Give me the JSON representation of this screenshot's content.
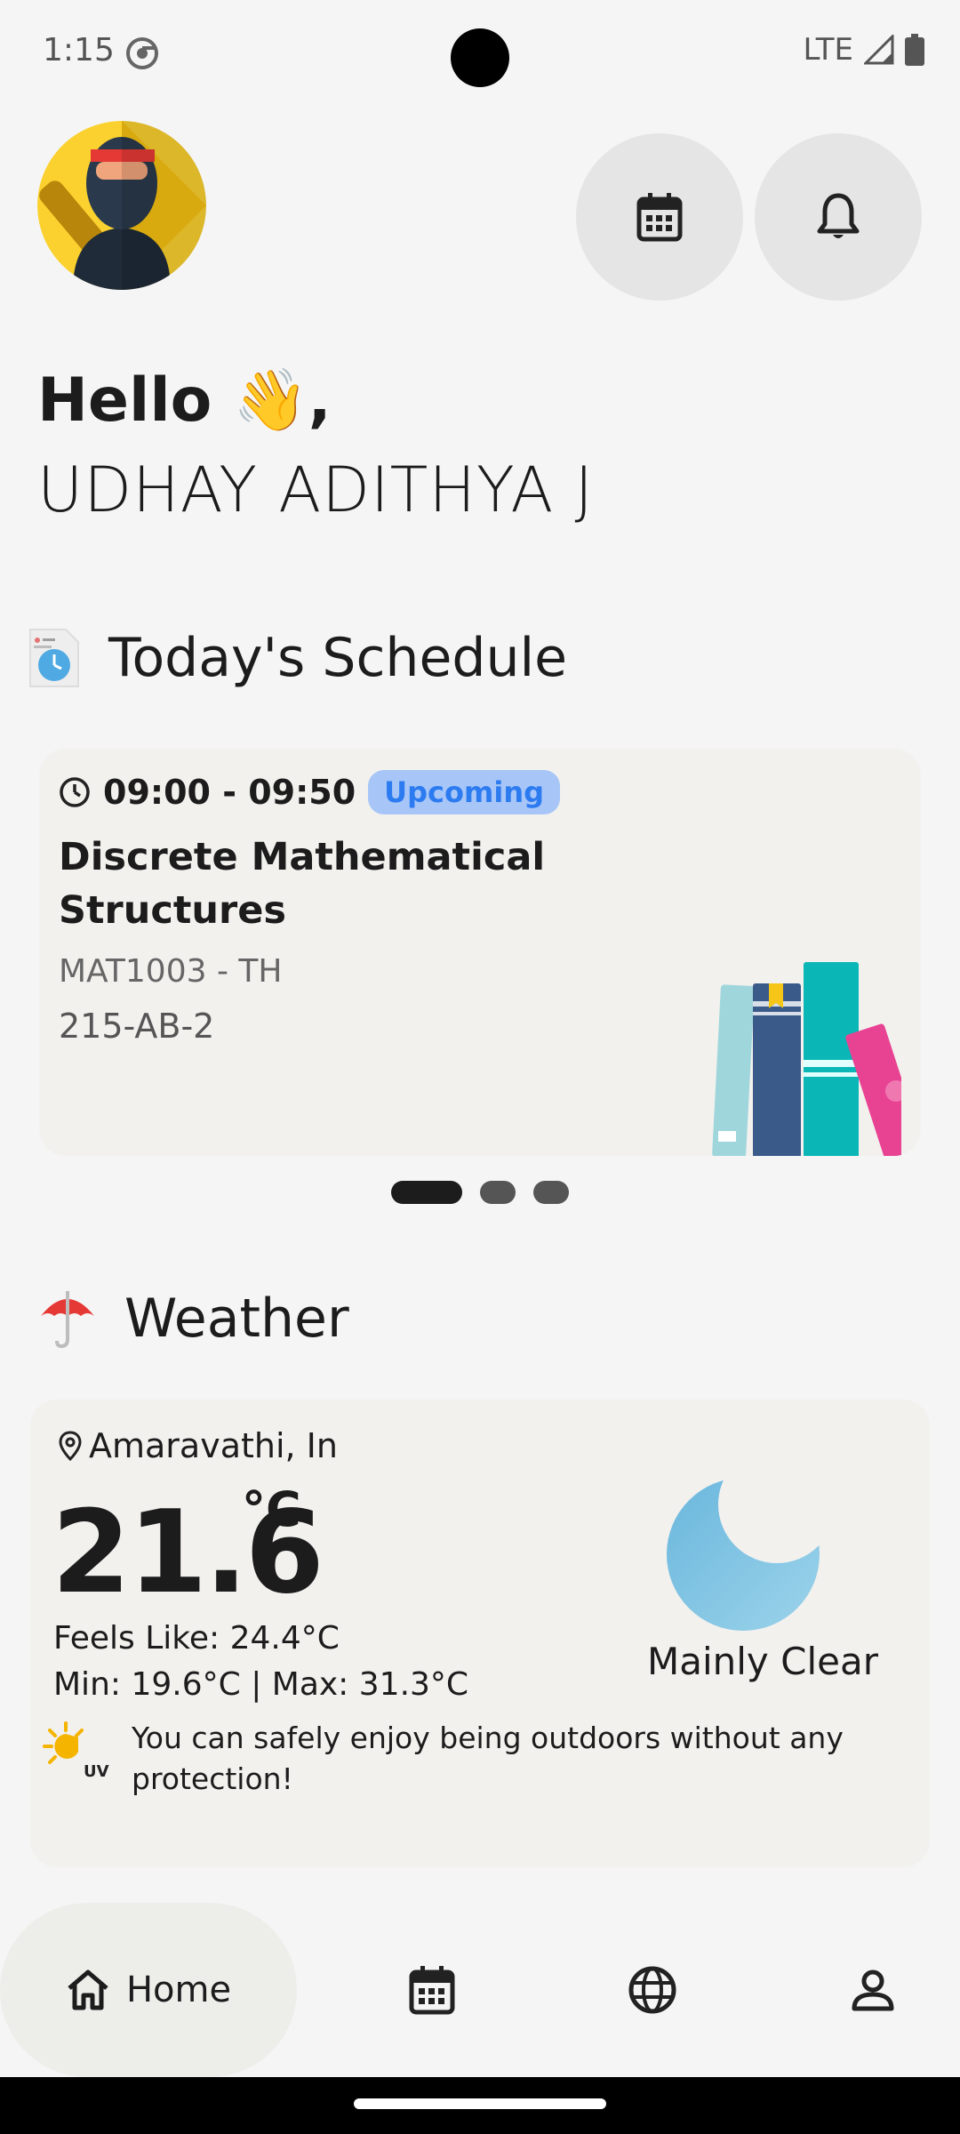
{
  "status_bar": {
    "time": "1:15",
    "network": "LTE"
  },
  "header": {
    "greeting": "Hello 👋,",
    "username": "UDHAY ADITHYA J"
  },
  "schedule": {
    "title": "Today's Schedule",
    "card": {
      "time": "09:00 - 09:50",
      "status": "Upcoming",
      "course_name": "Discrete Mathematical Structures",
      "course_code": "MAT1003 - TH",
      "room": "215-AB-2"
    },
    "pager": {
      "pages": 3,
      "current": 1
    }
  },
  "weather": {
    "title": "Weather",
    "location": "Amaravathi, In",
    "temperature": "21.6",
    "unit": "°C",
    "feels_like": "Feels Like: 24.4°C",
    "min_max": "Min: 19.6°C | Max: 31.3°C",
    "condition": "Mainly Clear",
    "uv_message": "You can safely enjoy being outdoors without any protection!",
    "uv_label": "UV"
  },
  "nav": {
    "home_label": "Home"
  },
  "colors": {
    "background": "#f5f5f5",
    "badge_bg": "#a7c6f7",
    "badge_text": "#2d7bf0",
    "card_bg": "#f2f1ee"
  },
  "icons": {
    "calendar": "calendar-icon",
    "bell": "bell-icon",
    "clock": "clock-icon",
    "location": "location-pin-icon",
    "umbrella": "umbrella-icon",
    "moon": "moon-icon",
    "home": "home-icon",
    "globe": "globe-icon",
    "profile": "profile-icon"
  }
}
